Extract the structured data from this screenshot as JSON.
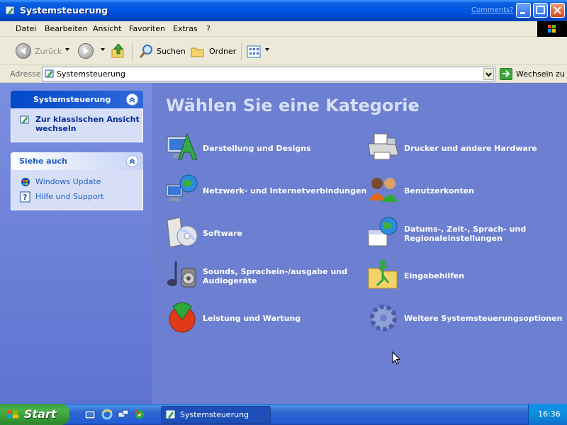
{
  "window": {
    "title": "Systemsteuerung",
    "comments_link": "Comments?"
  },
  "menu": [
    "Datei",
    "Bearbeiten",
    "Ansicht",
    "Favoriten",
    "Extras",
    "?"
  ],
  "toolbar": {
    "back": "Zurück",
    "search": "Suchen",
    "folders": "Ordner"
  },
  "address": {
    "label": "Adresse",
    "value": "Systemsteuerung",
    "go": "Wechseln zu"
  },
  "left_pane": {
    "panel1": {
      "title": "Systemsteuerung",
      "link_line1": "Zur klassischen Ansicht",
      "link_line2": "wechseln"
    },
    "panel2": {
      "title": "Siehe auch",
      "links": [
        "Windows Update",
        "Hilfe und Support"
      ]
    }
  },
  "main": {
    "heading": "Wählen Sie eine Kategorie",
    "categories": [
      {
        "icon": "appearance-icon",
        "line1": "Darstellung und Designs",
        "line2": ""
      },
      {
        "icon": "network-icon",
        "line1": "Netzwerk- und Internetverbindungen",
        "line2": ""
      },
      {
        "icon": "software-icon",
        "line1": "Software",
        "line2": ""
      },
      {
        "icon": "sounds-icon",
        "line1": "Sounds, Sprachein-/ausgabe und",
        "line2": "Audiogeräte"
      },
      {
        "icon": "performance-icon",
        "line1": "Leistung und Wartung",
        "line2": ""
      },
      {
        "icon": "printer-icon",
        "line1": "Drucker und andere Hardware",
        "line2": ""
      },
      {
        "icon": "user-accounts-icon",
        "line1": "Benutzerkonten",
        "line2": ""
      },
      {
        "icon": "date-time-icon",
        "line1": "Datums-, Zeit-, Sprach- und",
        "line2": "Regionaleinstellungen"
      },
      {
        "icon": "accessibility-icon",
        "line1": "Eingabehilfen",
        "line2": ""
      },
      {
        "icon": "gear-icon",
        "line1": "Weitere Systemsteuerungsoptionen",
        "line2": ""
      }
    ]
  },
  "taskbar": {
    "start": "Start",
    "task": "Systemsteuerung",
    "clock": "16:36"
  },
  "colors": {
    "title_blue": "#0054e3",
    "main_bg": "#6c7fd0",
    "link_blue": "#215dc6"
  }
}
